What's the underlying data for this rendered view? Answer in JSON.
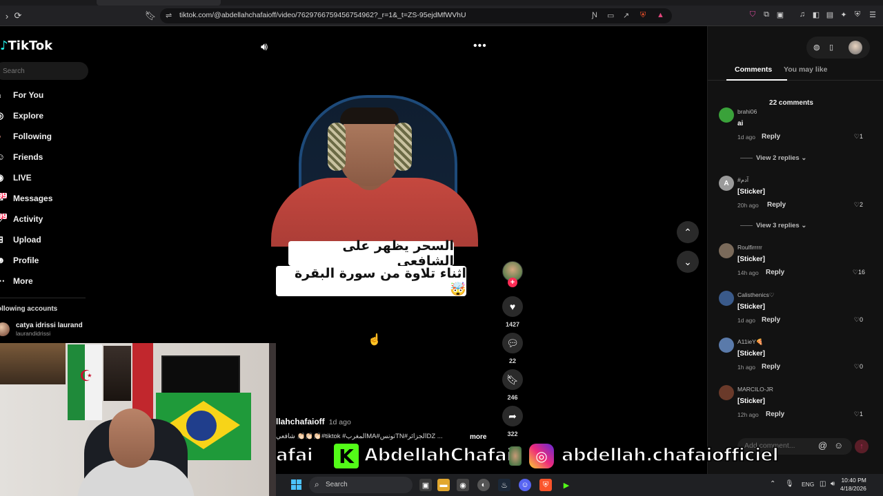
{
  "browser": {
    "url": "tiktok.com/@abdellahchafaioff/video/7629766759456754962?_r=1&_t=ZS-95ejdMfWVhU"
  },
  "sidebar": {
    "logo": "TikTok",
    "search_placeholder": "Search",
    "nav": [
      {
        "label": "For You",
        "icon": "home-icon"
      },
      {
        "label": "Explore",
        "icon": "compass-icon"
      },
      {
        "label": "Following",
        "icon": "following-icon"
      },
      {
        "label": "Friends",
        "icon": "friends-icon"
      },
      {
        "label": "LIVE",
        "icon": "live-icon"
      },
      {
        "label": "Messages",
        "icon": "messages-icon",
        "badge": "99+"
      },
      {
        "label": "Activity",
        "icon": "activity-icon",
        "badge": "99+"
      },
      {
        "label": "Upload",
        "icon": "upload-icon"
      },
      {
        "label": "Profile",
        "icon": "profile-icon"
      },
      {
        "label": "More",
        "icon": "more-icon"
      }
    ],
    "following_title": "ollowing accounts",
    "following": [
      {
        "name": "catya idrissi laurand",
        "username": "laurandidrissi"
      }
    ]
  },
  "video": {
    "caption_line1": "السحر يظهر على الشافعي",
    "caption_line2": "اثناء تلاوة من سورة البقرة 🤯",
    "author": "llahchafaioff",
    "posted": "1d ago",
    "description": "شافعي 👏🏻👏🏻👏🏻#tiktok #المغربMA#تونسTN#الجزائرDZ ...",
    "more_label": "more"
  },
  "actions": {
    "likes": "1427",
    "comments": "22",
    "saves": "246",
    "shares": "322"
  },
  "comments_panel": {
    "tab_comments": "Comments",
    "tab_you_may_like": "You may like",
    "count_label": "22 comments",
    "reply_label": "Reply",
    "items": [
      {
        "user": "brahi06",
        "text": "ai",
        "time": "1d ago",
        "likes": "1",
        "avatar_color": "#3aa23a"
      },
      {
        "user": "#آدم",
        "text": "[Sticker]",
        "time": "20h ago",
        "likes": "2",
        "avatar_color": "#9a9a9a",
        "avatar_letter": "A"
      },
      {
        "user": "Roulfirrrrr",
        "text": "[Sticker]",
        "time": "14h ago",
        "likes": "16",
        "avatar_color": "#7a6a5a"
      },
      {
        "user": "Calisthenics♡",
        "text": "[Sticker]",
        "time": "1d ago",
        "likes": "0",
        "avatar_color": "#3a5a8a"
      },
      {
        "user": "A11ieY🍕",
        "text": "[Sticker]",
        "time": "1h ago",
        "likes": "0",
        "avatar_color": "#5a7aaa"
      },
      {
        "user": "MARCILO-JR",
        "text": "[Sticker]",
        "time": "12h ago",
        "likes": "1",
        "avatar_color": "#6a3a2a"
      }
    ],
    "view_replies": [
      "View 2 replies",
      "View 3 replies"
    ],
    "add_comment_placeholder": "Add comment..."
  },
  "stream_banner": {
    "left_text": "afai",
    "kick_name": "AbdellahChafai",
    "instagram_name": "abdellah.chafaiofficiel"
  },
  "taskbar": {
    "search_label": "Search",
    "language": "ENG",
    "time": "10:40 PM",
    "date": "4/18/2026"
  },
  "colors": {
    "tiktok_red": "#fe2c55",
    "kick_green": "#53fc18",
    "background": "#000000",
    "panel": "#121212"
  }
}
